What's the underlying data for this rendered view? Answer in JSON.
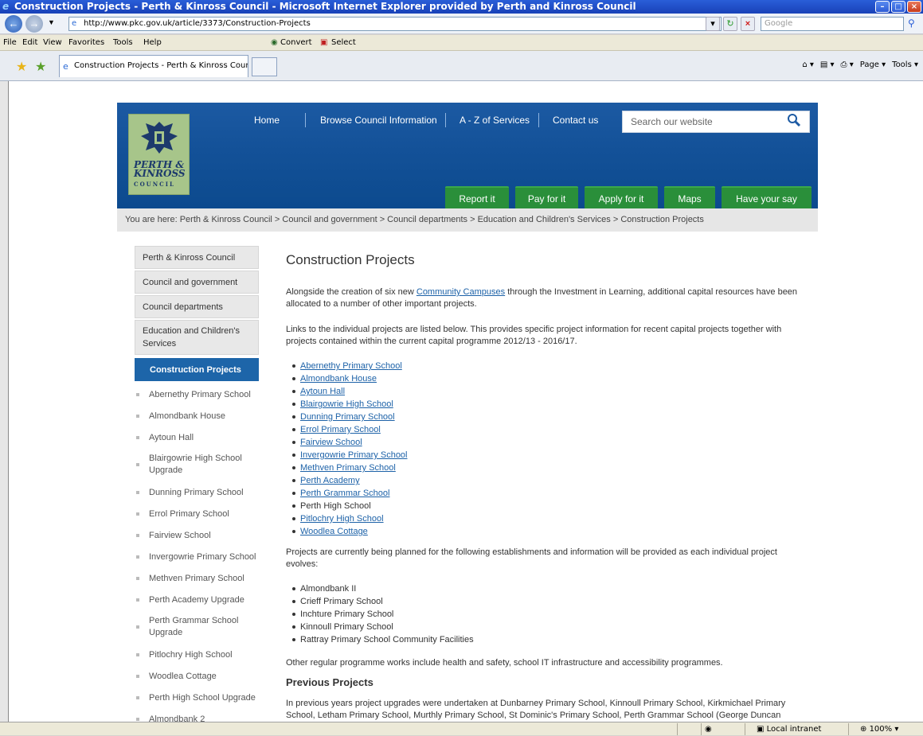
{
  "browser": {
    "title": "Construction Projects - Perth & Kinross Council - Microsoft Internet Explorer provided by Perth and Kinross Council",
    "url": "http://www.pkc.gov.uk/article/3373/Construction-Projects",
    "search_placeholder": "Google",
    "menu": [
      "File",
      "Edit",
      "View",
      "Favorites",
      "Tools",
      "Help"
    ],
    "extra_menu": [
      "Convert",
      "Select"
    ],
    "tab_label": "Construction Projects - Perth & Kinross Council",
    "tab_tools": [
      "Page",
      "Tools"
    ],
    "status": {
      "zone": "Local intranet",
      "zoom": "100%"
    }
  },
  "site": {
    "logo_lines": [
      "PERTH &",
      "KINROSS",
      "COUNCIL"
    ],
    "top_nav": [
      "Home",
      "Browse Council Information",
      "A - Z of Services",
      "Contact us"
    ],
    "search_placeholder": "Search our website",
    "green_tabs": [
      "Report it",
      "Pay for it",
      "Apply for it",
      "Maps",
      "Have your say"
    ],
    "breadcrumb": "You are here: Perth & Kinross Council > Council and government > Council departments > Education and Children's Services > Construction Projects",
    "sidebar": {
      "sections": [
        "Perth & Kinross Council",
        "Council and government",
        "Council departments",
        "Education and Children's Services"
      ],
      "active": "Construction Projects",
      "subitems": [
        "Abernethy Primary School",
        "Almondbank House",
        "Aytoun Hall",
        "Blairgowrie High School Upgrade",
        "Dunning Primary School",
        "Errol Primary School",
        "Fairview School",
        "Invergowrie Primary School",
        "Methven Primary School",
        "Perth Academy Upgrade",
        "Perth Grammar School Upgrade",
        "Pitlochry High School",
        "Woodlea Cottage",
        "Perth High School Upgrade",
        "Almondbank 2"
      ]
    },
    "content": {
      "title": "Construction Projects",
      "intro_pre": "Alongside the creation of six new ",
      "intro_link": "Community Campuses",
      "intro_post": " through the Investment in Learning, additional capital resources have been allocated to a number of other important projects.",
      "links_para": "Links to the individual projects are listed below. This provides specific project information for recent capital projects together with projects contained within the current capital programme 2012/13 - 2016/17.",
      "project_links": [
        "Abernethy Primary School",
        "Almondbank House",
        "Aytoun Hall",
        "Blairgowrie High School",
        "Dunning Primary School",
        "Errol Primary School",
        "Fairview School",
        "Invergowrie Primary School",
        "Methven Primary School",
        "Perth Academy",
        "Perth Grammar School",
        "Perth High School",
        "Pitlochry High School",
        "Woodlea Cottage"
      ],
      "planned_para": "Projects are currently being planned for the following establishments and information will be provided as each individual project evolves:",
      "planned": [
        "Almondbank II",
        "Crieff Primary School",
        "Inchture Primary School",
        "Kinnoull Primary School",
        "Rattray Primary School Community Facilities"
      ],
      "other_para": "Other regular programme works include health and safety, school IT infrastructure and accessibility programmes.",
      "previous_heading": "Previous Projects",
      "previous_para": "In previous years project upgrades were undertaken at Dunbarney Primary School, Kinnoull Primary School, Kirkmichael Primary School, Letham Primary School, Murthly Primary School, St Dominic's Primary School, Perth Grammar School (George Duncan"
    }
  }
}
